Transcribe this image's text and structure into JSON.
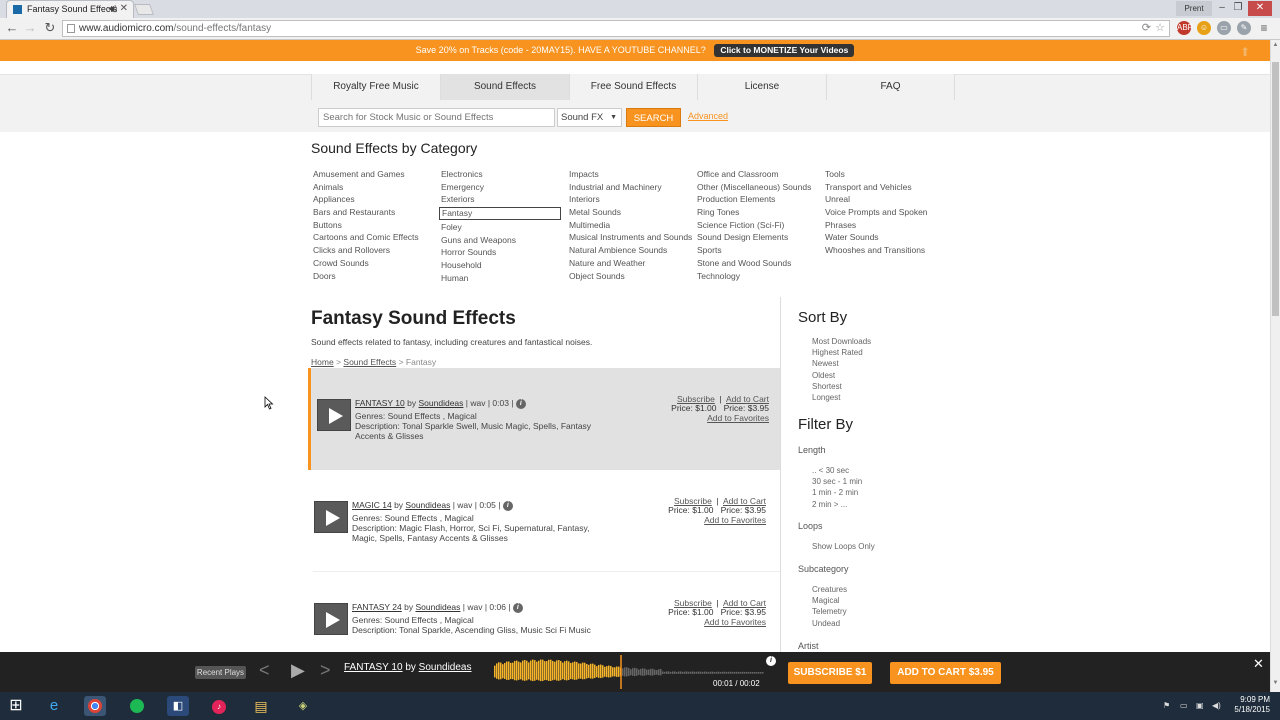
{
  "browser": {
    "tab_title": "Fantasy Sound Effects",
    "url_domain": "www.audiomicro.com",
    "url_path": "/sound-effects/fantasy",
    "user_label": "Prent"
  },
  "promo": {
    "text": "Save 20% on Tracks (code - 20MAY15). HAVE A YOUTUBE CHANNEL?",
    "button": "Click to MONETIZE Your Videos"
  },
  "nav": {
    "tabs": [
      "Royalty Free Music",
      "Sound Effects",
      "Free Sound Effects",
      "License",
      "FAQ"
    ]
  },
  "search": {
    "placeholder": "Search for Stock Music or Sound Effects",
    "select_value": "Sound FX",
    "button": "SEARCH",
    "advanced": "Advanced"
  },
  "categories": {
    "heading": "Sound Effects by Category",
    "col1": [
      "Amusement and Games",
      "Animals",
      "Appliances",
      "Bars and Restaurants",
      "Buttons",
      "Cartoons and Comic Effects",
      "Clicks and Rollovers",
      "Crowd Sounds",
      "Doors"
    ],
    "col2": [
      "Electronics",
      "Emergency",
      "Exteriors",
      "Fantasy",
      "Foley",
      "Guns and Weapons",
      "Horror Sounds",
      "Household",
      "Human"
    ],
    "col3": [
      "Impacts",
      "Industrial and Machinery",
      "Interiors",
      "Metal Sounds",
      "Multimedia",
      "Musical Instruments and Sounds",
      "Natural Ambience Sounds",
      "Nature and Weather",
      "Object Sounds"
    ],
    "col4": [
      "Office and Classroom",
      "Other (Miscellaneous) Sounds",
      "Production Elements",
      "Ring Tones",
      "Science Fiction (Sci-Fi)",
      "Sound Design Elements",
      "Sports",
      "Stone and Wood Sounds",
      "Technology"
    ],
    "col5": [
      "Tools",
      "Transport and Vehicles",
      "Unreal",
      "Voice Prompts and Spoken Phrases",
      "Water Sounds",
      "Whooshes and Transitions"
    ]
  },
  "results": {
    "title": "Fantasy Sound Effects",
    "description": "Sound effects related to fantasy, including creatures and fantastical noises.",
    "breadcrumb": {
      "home": "Home",
      "sep": ">",
      "section": "Sound Effects",
      "current": "Fantasy"
    },
    "tracks": [
      {
        "name": "FANTASY 10",
        "by": "by",
        "artist": "Soundideas",
        "format": "wav",
        "duration": "0:03",
        "genres": "Genres: Sound Effects , Magical",
        "description": "Description: Tonal Sparkle Swell, Music Magic, Spells, Fantasy Accents & Glisses",
        "subscribe": "Subscribe",
        "add_to_cart": "Add to Cart",
        "price_sub": "Price: $1.00",
        "price_cart": "Price: $3.95",
        "favorites": "Add to Favorites"
      },
      {
        "name": "MAGIC 14",
        "by": "by",
        "artist": "Soundideas",
        "format": "wav",
        "duration": "0:05",
        "genres": "Genres: Sound Effects , Magical",
        "description": "Description: Magic Flash, Horror, Sci Fi, Supernatural, Fantasy, Magic, Spells, Fantasy Accents & Glisses",
        "subscribe": "Subscribe",
        "add_to_cart": "Add to Cart",
        "price_sub": "Price: $1.00",
        "price_cart": "Price: $3.95",
        "favorites": "Add to Favorites"
      },
      {
        "name": "FANTASY 24",
        "by": "by",
        "artist": "Soundideas",
        "format": "wav",
        "duration": "0:06",
        "genres": "Genres: Sound Effects , Magical",
        "description": "Description: Tonal Sparkle, Ascending Gliss, Music Sci Fi Music",
        "subscribe": "Subscribe",
        "add_to_cart": "Add to Cart",
        "price_sub": "Price: $1.00",
        "price_cart": "Price: $3.95",
        "favorites": "Add to Favorites"
      }
    ]
  },
  "sidebar": {
    "sort_heading": "Sort By",
    "sort_items": [
      "Most Downloads",
      "Highest Rated",
      "Newest",
      "Oldest",
      "Shortest",
      "Longest"
    ],
    "filter_heading": "Filter By",
    "length_label": "Length",
    "length_items": [
      ".. < 30 sec",
      "30 sec - 1 min",
      "1 min - 2 min",
      "2 min > ..."
    ],
    "loops_label": "Loops",
    "loops_items": [
      "Show Loops Only"
    ],
    "subcategory_label": "Subcategory",
    "subcategory_items": [
      "Creatures",
      "Magical",
      "Telemetry",
      "Undead"
    ],
    "artist_label": "Artist"
  },
  "player": {
    "recent_plays": "Recent Plays",
    "track": "FANTASY 10",
    "by": "by",
    "artist": "Soundideas",
    "time": "00:01 / 00:02",
    "progress_fraction": 0.5,
    "subscribe": "SUBSCRIBE $1",
    "add_to_cart": "ADD TO CART $3.95"
  },
  "taskbar": {
    "time": "9:09 PM",
    "date": "5/18/2015"
  },
  "colors": {
    "accent": "#f7931e",
    "player_bg": "#222222",
    "taskbar_bg": "#1e2c3b"
  }
}
